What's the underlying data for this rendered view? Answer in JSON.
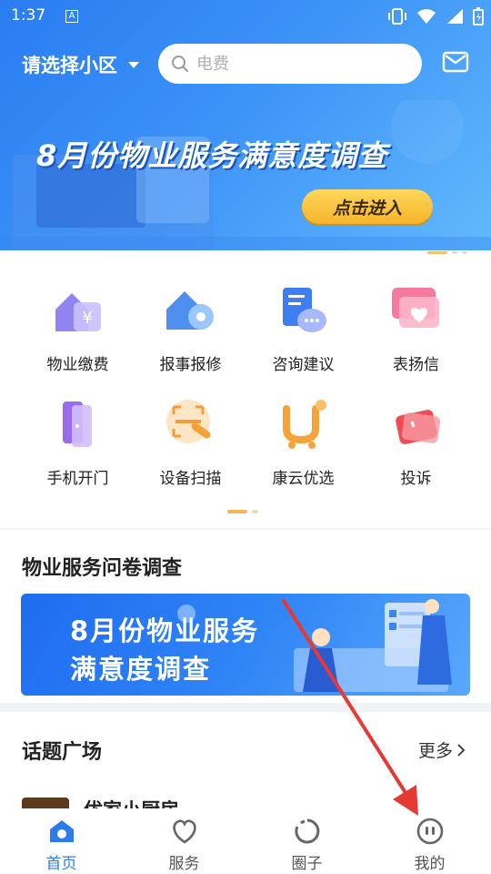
{
  "status_bar": {
    "time": "1:37",
    "app_badge": "A"
  },
  "header": {
    "community_selector": "请选择小区",
    "search_placeholder": "电费"
  },
  "banner": {
    "title": "8月份物业服务满意度调查",
    "button_label": "点击进入",
    "page_count": 3,
    "active_page": 1
  },
  "grid": {
    "items": [
      {
        "label": "物业缴费",
        "icon": "property-fee-icon"
      },
      {
        "label": "报事报修",
        "icon": "repair-icon"
      },
      {
        "label": "咨询建议",
        "icon": "consult-icon"
      },
      {
        "label": "表扬信",
        "icon": "praise-letter-icon"
      },
      {
        "label": "手机开门",
        "icon": "phone-door-icon"
      },
      {
        "label": "设备扫描",
        "icon": "scan-icon"
      },
      {
        "label": "康云优选",
        "icon": "shop-cart-icon"
      },
      {
        "label": "投诉",
        "icon": "complaint-icon"
      }
    ]
  },
  "survey": {
    "section_title": "物业服务问卷调查",
    "banner_line1": "8月份物业服务",
    "banner_line2": "满意度调查"
  },
  "topics": {
    "section_title": "话题广场",
    "more_label": "更多",
    "first_item_partial": "优家小厨房"
  },
  "tabbar": {
    "tabs": [
      {
        "label": "首页",
        "icon": "home-icon",
        "active": true
      },
      {
        "label": "服务",
        "icon": "heart-icon",
        "active": false
      },
      {
        "label": "圈子",
        "icon": "circle-icon",
        "active": false
      },
      {
        "label": "我的",
        "icon": "profile-icon",
        "active": false
      }
    ]
  },
  "colors": {
    "brand_blue": "#2c7cf0",
    "button_yellow": "#f6b42b",
    "arrow_red": "#e53935"
  }
}
